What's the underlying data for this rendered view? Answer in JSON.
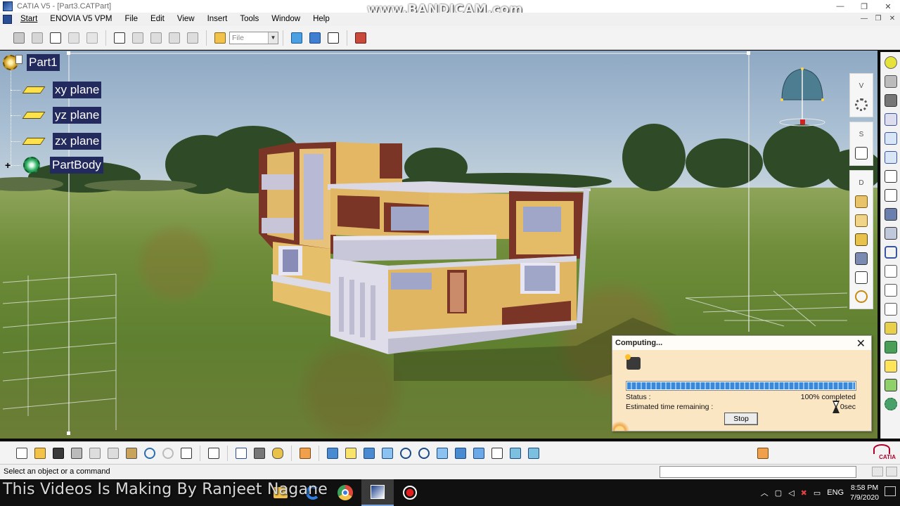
{
  "window": {
    "title": "CATIA V5 - [Part3.CATPart]",
    "watermark": "www.BANDICAM.com",
    "controls": [
      "—",
      "❐",
      "✕"
    ]
  },
  "menubar": {
    "items": [
      "Start",
      "ENOVIA V5 VPM",
      "File",
      "Edit",
      "View",
      "Insert",
      "Tools",
      "Window",
      "Help"
    ],
    "doc_controls": [
      "—",
      "❐",
      "✕"
    ]
  },
  "toolbar_top": {
    "file_combo": "File"
  },
  "spec_tree": {
    "root": "Part1",
    "items": [
      "xy plane",
      "yz plane",
      "zx plane",
      "PartBody"
    ]
  },
  "right_panel": {
    "labels": [
      "V",
      "S",
      "D"
    ]
  },
  "dialog": {
    "title": "Computing...",
    "progress": 1.0,
    "status_label": "Status :",
    "status_value": "100% completed",
    "eta_label": "Estimated time remaining :",
    "eta_value": "0sec",
    "stop_label": "Stop"
  },
  "status_bar": {
    "prompt": "Select an object or a command"
  },
  "overlay": {
    "caption": "This Videos Is Making By Ranjeet Nagane"
  },
  "taskbar": {
    "lang": "ENG",
    "time": "8:58 PM",
    "date": "7/9/2020"
  },
  "brand": {
    "catia_logo": "CATIA",
    "accent": "#232a5e",
    "plane_color": "#ffe14b",
    "dialog_bg": "#fbe6c4"
  }
}
